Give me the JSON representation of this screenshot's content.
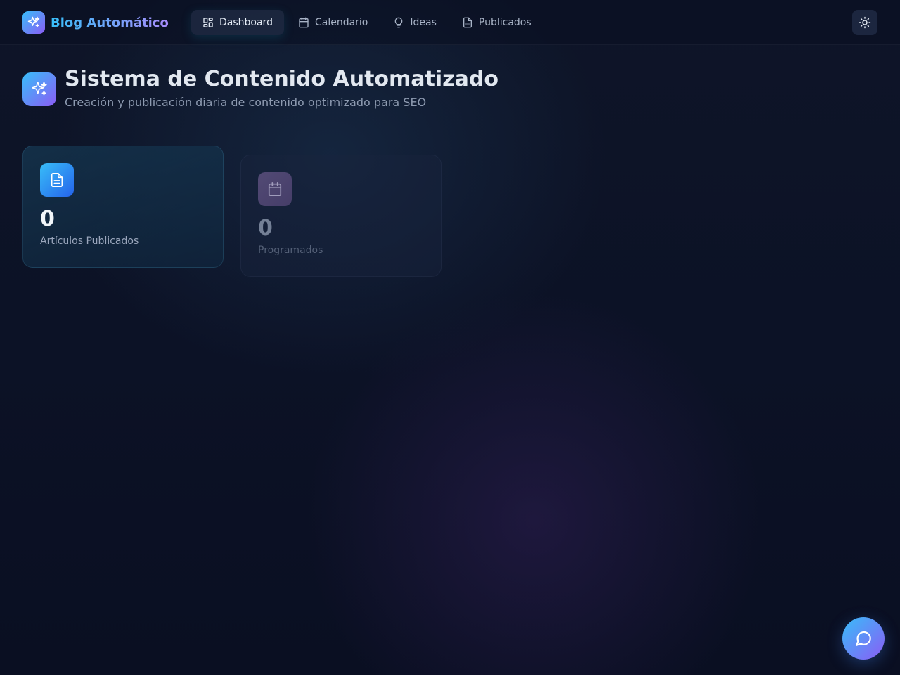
{
  "brand": {
    "name": "Blog Automático",
    "icon": "sparkles-icon"
  },
  "nav": {
    "items": [
      {
        "label": "Dashboard",
        "icon": "dashboard-icon",
        "active": true
      },
      {
        "label": "Calendario",
        "icon": "calendar-icon",
        "active": false
      },
      {
        "label": "Ideas",
        "icon": "lightbulb-icon",
        "active": false
      },
      {
        "label": "Publicados",
        "icon": "file-text-icon",
        "active": false
      }
    ],
    "theme_toggle_icon": "sun-icon"
  },
  "header": {
    "title": "Sistema de Contenido Automatizado",
    "subtitle": "Creación y publicación diaria de contenido optimizado para SEO",
    "icon": "sparkles-icon"
  },
  "stats": [
    {
      "value": "0",
      "label": "Artículos Publicados",
      "icon": "file-text-icon"
    },
    {
      "value": "0",
      "label": "Programados",
      "icon": "calendar-icon"
    }
  ],
  "chat": {
    "icon": "chat-bubble-icon"
  },
  "colors": {
    "accent_start": "#38bdf8",
    "accent_end": "#8b5cf6",
    "background": "#0c1226"
  }
}
